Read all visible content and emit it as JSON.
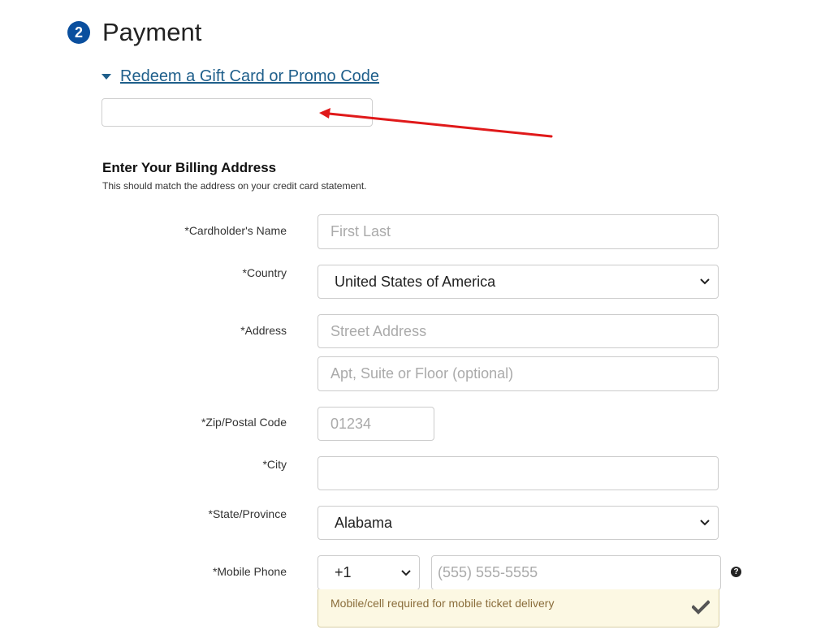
{
  "header": {
    "step_number": "2",
    "title": "Payment"
  },
  "promo": {
    "link_label": "Redeem a Gift Card or Promo Code",
    "input_value": "",
    "input_placeholder": ""
  },
  "billing": {
    "title": "Enter Your Billing Address",
    "subtitle": "This should match the address on your credit card statement."
  },
  "form": {
    "cardholder": {
      "label": "*Cardholder's Name",
      "placeholder": "First Last",
      "value": ""
    },
    "country": {
      "label": "*Country",
      "selected": "United States of America"
    },
    "address": {
      "label": "*Address",
      "line1_placeholder": "Street Address",
      "line2_placeholder": "Apt, Suite or Floor (optional)"
    },
    "zip": {
      "label": "*Zip/Postal Code",
      "placeholder": "01234"
    },
    "city": {
      "label": "*City",
      "placeholder": ""
    },
    "state": {
      "label": "*State/Province",
      "selected": "Alabama"
    },
    "phone": {
      "label": "*Mobile Phone",
      "country_code": "+1",
      "placeholder": "(555) 555-5555",
      "help_glyph": "?",
      "notice": "Mobile/cell required for mobile ticket delivery"
    }
  },
  "colors": {
    "badge": "#0a4f9e",
    "link": "#1f5f8b",
    "annotation_arrow": "#e0191a",
    "notice_bg": "#fcf8e3",
    "notice_text": "#8a6d3b"
  },
  "icons": {
    "toggle": "caret-down-icon",
    "select": "chevron-down-icon",
    "help": "question-circle-icon",
    "valid": "checkmark-icon",
    "annotation": "red-arrow-icon"
  }
}
